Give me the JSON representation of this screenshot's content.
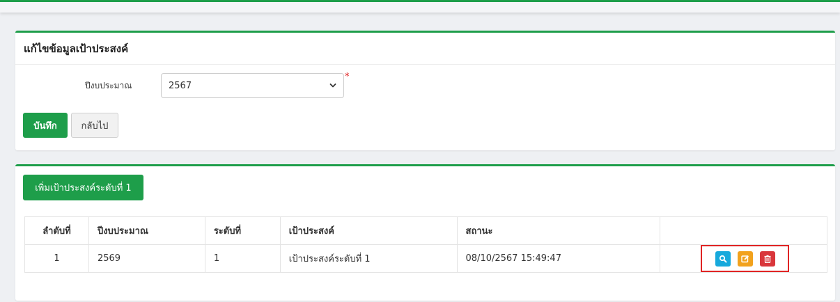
{
  "form_card": {
    "title": "แก้ไขข้อมูลเป้าประสงค์",
    "budget_year_label": "ปีงบประมาณ",
    "budget_year_value": "2567",
    "required_mark": "*",
    "save_label": "บันทึก",
    "back_label": "กลับไป"
  },
  "list_card": {
    "add_button_label": "เพิ่มเป้าประสงค์ระดับที่ 1",
    "columns": [
      "ลำดับที่",
      "ปีงบประมาณ",
      "ระดับที่",
      "เป้าประสงค์",
      "สถานะ",
      ""
    ],
    "rows": [
      {
        "no": "1",
        "year": "2569",
        "level": "1",
        "goal": "เป้าประสงค์ระดับที่ 1",
        "status": "08/10/2567 15:49:47",
        "actions": [
          "search-icon",
          "edit-icon",
          "trash-icon"
        ]
      }
    ]
  },
  "colors": {
    "accent": "#1e9e4a",
    "view": "#17a9dc",
    "edit": "#f2a21d",
    "delete": "#d9363b",
    "highlight": "#e02424"
  }
}
